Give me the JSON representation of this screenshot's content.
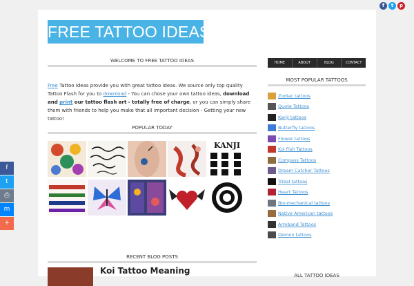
{
  "site": {
    "logo": "FREE TATTOO IDEAS"
  },
  "welcome": {
    "title": "WELCOME TO FREE TATTOO IDEAS"
  },
  "intro": {
    "p1": "Free",
    "p2": " Tattoo Ideas provide you with great tattoo ideas. We source only top quality Tattoo Flash for you to ",
    "p3": "download",
    "p4": " - You can chose your own tattoo ideas, ",
    "p5": "download and ",
    "p6": "print",
    "p7": " our tattoo flash art - totally free of charge",
    "p8": ", or you can simply share them with friends to help you make that all important decision - Getting your new tattoo!"
  },
  "popular_today": {
    "title": "POPULAR TODAY",
    "kanji_label": "KANJI"
  },
  "recent": {
    "title": "RECENT BLOG POSTS",
    "first_post_title": "Koi Tattoo Meaning"
  },
  "nav": [
    "HOME",
    "ABOUT",
    "BLOG",
    "CONTACT"
  ],
  "sidebar": {
    "title": "MOST POPULAR TATTOOS",
    "items": [
      "Zodiac tattoos",
      "Quote Tattoos",
      "Kanji tattoos",
      "Butterfly tattoos",
      "Flower tattoos",
      "Koi Fish Tattoos",
      "Compass Tattoos",
      "Dream Catcher Tattoos",
      "Tribal tattoos",
      "Heart Tattoos",
      "Bio-mechanical tattoos",
      "Native American tattoos",
      "Armband Tattoos",
      "Demon tattoos"
    ],
    "all_title": "ALL TATTOO IDEAS"
  },
  "social_top": [
    {
      "icon": "facebook-icon",
      "glyph": "f",
      "color": "#3b5998"
    },
    {
      "icon": "twitter-icon",
      "glyph": "t",
      "color": "#1da1f2"
    },
    {
      "icon": "pinterest-icon",
      "glyph": "p",
      "color": "#cb2027"
    }
  ],
  "share_side": [
    {
      "icon": "facebook-icon",
      "glyph": "f",
      "color": "#3b5998"
    },
    {
      "icon": "twitter-icon",
      "glyph": "t",
      "color": "#1da1f2"
    },
    {
      "icon": "print-icon",
      "glyph": "⎙",
      "color": "#6d7b8d"
    },
    {
      "icon": "messenger-icon",
      "glyph": "m",
      "color": "#0084ff"
    },
    {
      "icon": "plus-icon",
      "glyph": "+",
      "color": "#f26a4b"
    }
  ],
  "colors": {
    "accent": "#4ab3e6",
    "nav_bg": "#2a2a2a",
    "link": "#3d8fd1"
  }
}
